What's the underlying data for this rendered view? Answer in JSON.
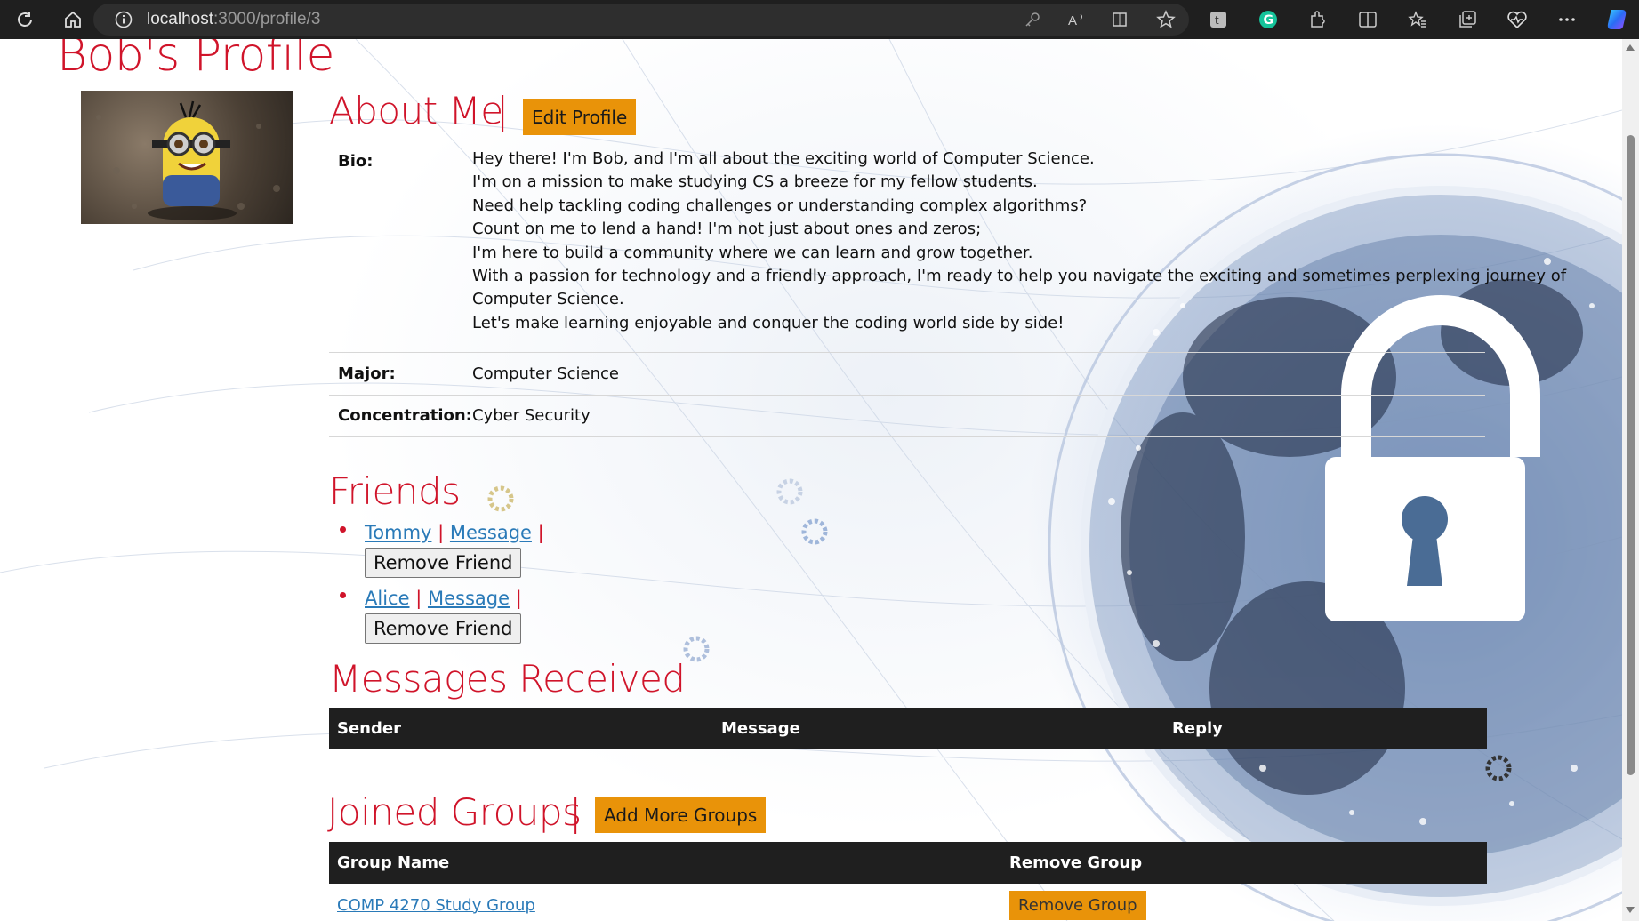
{
  "browser": {
    "url_host": "localhost",
    "url_rest": ":3000/profile/3"
  },
  "profile": {
    "title": "Bob's Profile"
  },
  "about": {
    "title": "About Me",
    "separator": "|",
    "edit_button": "Edit Profile",
    "bio_label": "Bio:",
    "bio_lines": [
      "Hey there! I'm Bob, and I'm all about the exciting world of Computer Science.",
      "I'm on a mission to make studying CS a breeze for my fellow students.",
      "Need help tackling coding challenges or understanding complex algorithms?",
      "Count on me to lend a hand! I'm not just about ones and zeros;",
      "I'm here to build a community where we can learn and grow together.",
      "With a passion for technology and a friendly approach, I'm ready to help you navigate the exciting and sometimes perplexing journey of",
      "Computer Science.",
      "Let's make learning enjoyable and conquer the coding world side by side!"
    ],
    "major_label": "Major:",
    "major_value": "Computer Science",
    "concentration_label": "Concentration:",
    "concentration_value": "Cyber Security"
  },
  "friends": {
    "title": "Friends",
    "items": [
      {
        "name": "Tommy",
        "message": "Message",
        "remove": "Remove Friend"
      },
      {
        "name": "Alice",
        "message": "Message",
        "remove": "Remove Friend"
      }
    ],
    "divider": "|"
  },
  "messages": {
    "title": "Messages Received",
    "columns": [
      "Sender",
      "Message",
      "Reply"
    ]
  },
  "groups": {
    "title": "Joined Groups",
    "separator": "|",
    "add_button": "Add More Groups",
    "columns": [
      "Group Name",
      "Remove Group"
    ],
    "rows": [
      {
        "name": "COMP 4270 Study Group",
        "remove": "Remove Group"
      }
    ]
  },
  "colors": {
    "accent_red": "#d0142a",
    "button_orange": "#e99309",
    "link_blue": "#2a7ab8",
    "table_header": "#1f1f1f"
  }
}
